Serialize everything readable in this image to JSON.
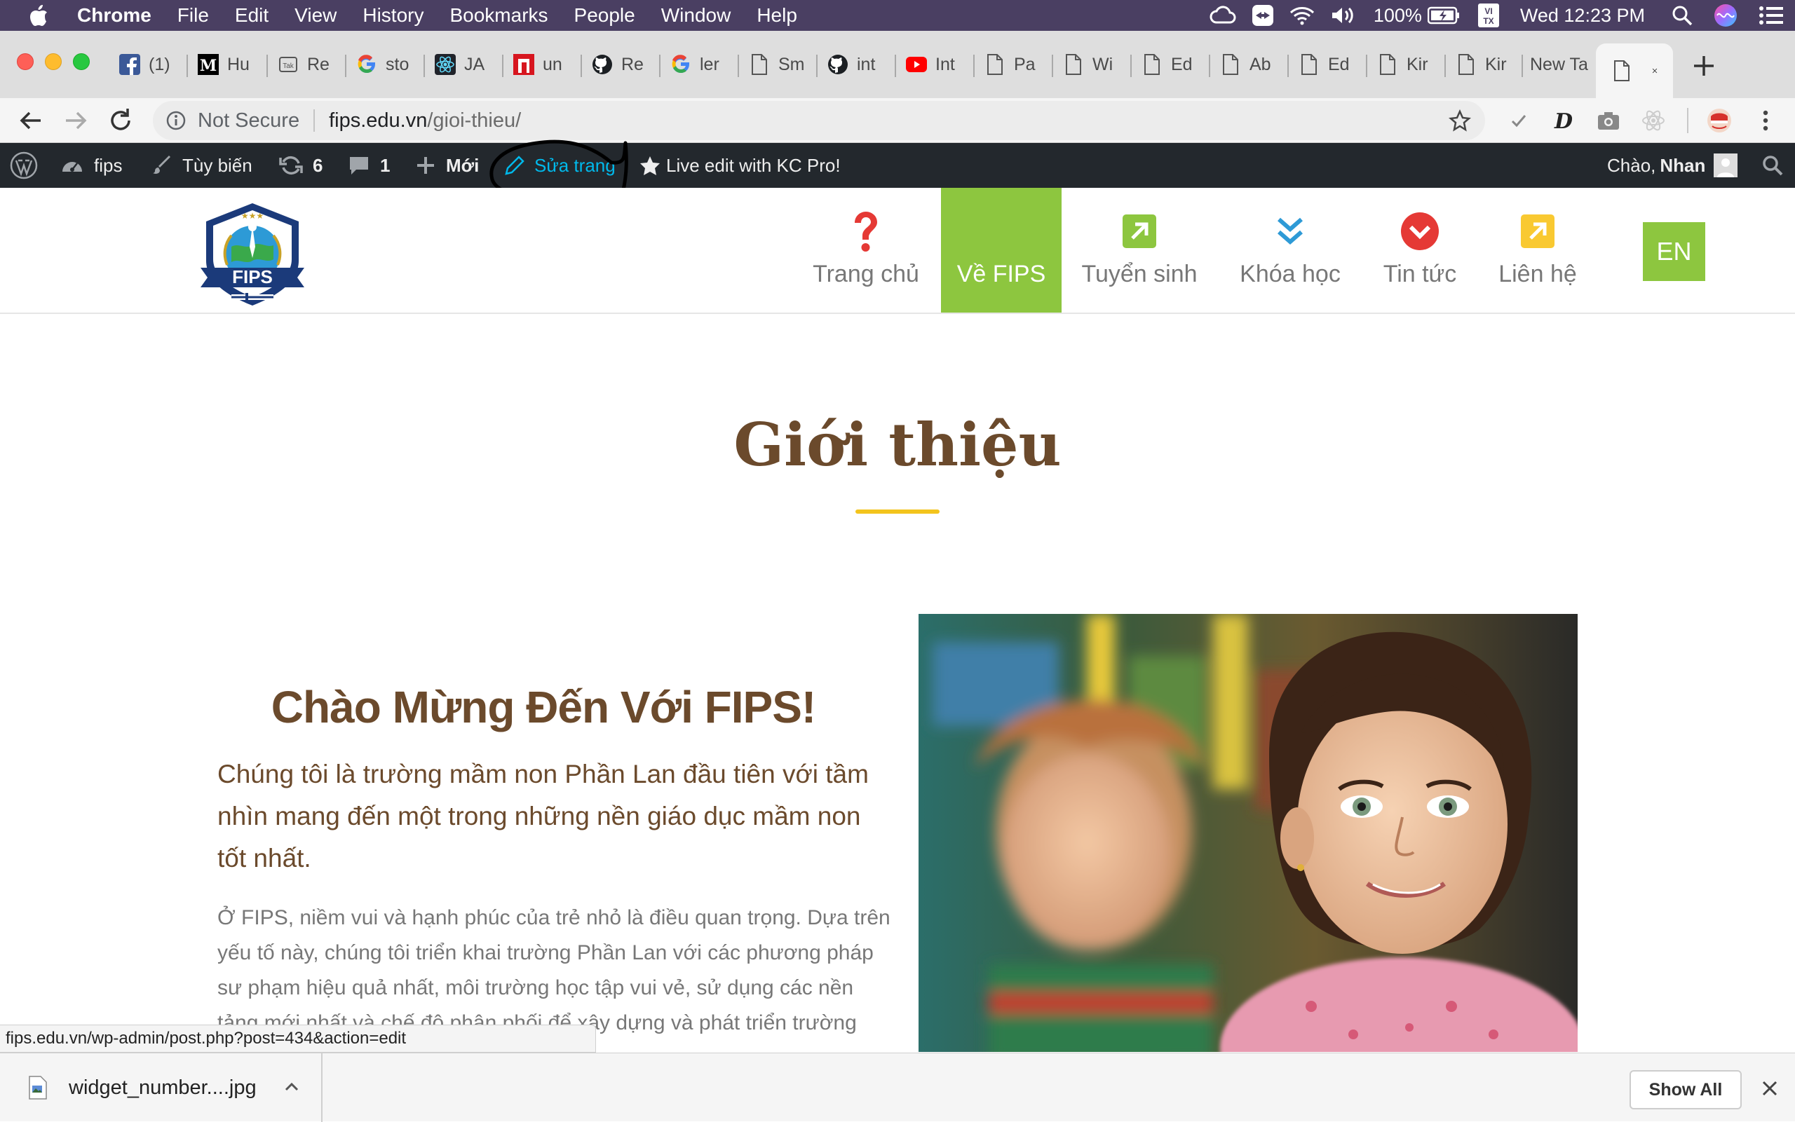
{
  "menubar": {
    "app": "Chrome",
    "items": [
      "File",
      "Edit",
      "View",
      "History",
      "Bookmarks",
      "People",
      "Window",
      "Help"
    ],
    "battery": "100%",
    "input_badge": "VI TX",
    "clock": "Wed 12:23 PM"
  },
  "tabs": [
    {
      "icon": "facebook-icon",
      "title": "(1)"
    },
    {
      "icon": "medium-icon",
      "title": "Hu"
    },
    {
      "icon": "tag-icon",
      "title": "Re"
    },
    {
      "icon": "google-icon",
      "title": "sto"
    },
    {
      "icon": "react-icon",
      "title": "JA"
    },
    {
      "icon": "red-square-icon",
      "title": "un"
    },
    {
      "icon": "github-icon",
      "title": "Re"
    },
    {
      "icon": "google-icon",
      "title": "ler"
    },
    {
      "icon": "page-icon",
      "title": "Sm"
    },
    {
      "icon": "github-icon",
      "title": "int"
    },
    {
      "icon": "youtube-icon",
      "title": "Int"
    },
    {
      "icon": "page-icon",
      "title": "Pa"
    },
    {
      "icon": "page-icon",
      "title": "Wi"
    },
    {
      "icon": "page-icon",
      "title": "Ed"
    },
    {
      "icon": "page-icon",
      "title": "Ab"
    },
    {
      "icon": "page-icon",
      "title": "Ed"
    },
    {
      "icon": "page-icon",
      "title": "Kir"
    },
    {
      "icon": "page-icon",
      "title": "Kir"
    },
    {
      "icon": "",
      "title": "New Ta"
    }
  ],
  "omnibox": {
    "security": "Not Secure",
    "host": "fips.edu.vn",
    "path": "/gioi-thieu/"
  },
  "wp_admin_bar": {
    "site": "fips",
    "customize": "Tùy biến",
    "updates": "6",
    "comments": "1",
    "new": "Mới",
    "edit_page": "Sửa trang",
    "live_edit": "Live edit with KC Pro!",
    "greeting": "Chào,",
    "user": "Nhan"
  },
  "site": {
    "logo_text": "FIPS",
    "nav": [
      {
        "label": "Trang chủ",
        "icon": "question-icon",
        "active": false
      },
      {
        "label": "Về FIPS",
        "icon": "",
        "active": true
      },
      {
        "label": "Tuyển sinh",
        "icon": "arrow-up-right-icon",
        "active": false
      },
      {
        "label": "Khóa học",
        "icon": "double-chevron-down-icon",
        "active": false
      },
      {
        "label": "Tin tức",
        "icon": "chevron-circle-down-icon",
        "active": false
      },
      {
        "label": "Liên hệ",
        "icon": "arrow-up-right-icon",
        "active": false
      }
    ],
    "lang": "EN"
  },
  "content": {
    "title": "Giới thiệu",
    "welcome": "Chào Mừng Đến Với FIPS!",
    "lead": "Chúng tôi là trường mầm non Phần Lan đầu tiên với tầm nhìn mang đến một trong những nền giáo dục mầm non tốt nhất.",
    "body": "Ở FIPS, niềm vui và hạnh phúc của trẻ nhỏ là điều quan trọng. Dựa trên yếu tố này, chúng tôi triển khai trường Phần Lan với các phương pháp sư phạm hiệu quả nhất, môi trường học tập vui vẻ, sử dụng các nền tảng mới nhất và chế độ phân phối để xây dựng và phát triển trường mầm non đầu tiên FIPS tại"
  },
  "status_bar": "fips.edu.vn/wp-admin/post.php?post=434&action=edit",
  "downloads": {
    "file": "widget_number....jpg",
    "show_all": "Show All"
  },
  "colors": {
    "accent_green": "#8dc63f",
    "brown": "#6b4a2c",
    "gold": "#f3c41d",
    "wp_bar": "#23282d",
    "wp_link": "#00b9eb"
  }
}
